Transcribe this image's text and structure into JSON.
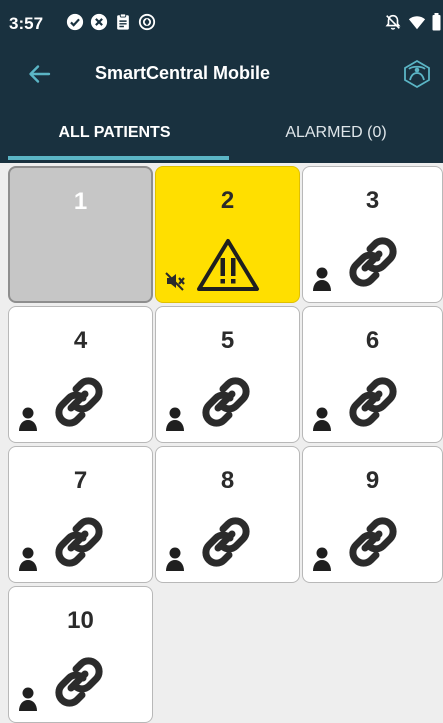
{
  "status": {
    "time": "3:57"
  },
  "app": {
    "title": "SmartCentral Mobile"
  },
  "tabs": {
    "all": "ALL PATIENTS",
    "alarmed": "ALARMED (0)"
  },
  "colors": {
    "header": "#19313f",
    "accent": "#5bb5c5",
    "alarm": "#ffdf00",
    "disabled": "#c6c6c6"
  },
  "beds": [
    {
      "number": "1",
      "state": "disabled"
    },
    {
      "number": "2",
      "state": "alarm",
      "icons": [
        "warning-icon",
        "muted-speaker-icon"
      ]
    },
    {
      "number": "3",
      "state": "linked",
      "icons": [
        "person-icon",
        "link-icon"
      ]
    },
    {
      "number": "4",
      "state": "linked",
      "icons": [
        "person-icon",
        "link-icon"
      ]
    },
    {
      "number": "5",
      "state": "linked",
      "icons": [
        "person-icon",
        "link-icon"
      ]
    },
    {
      "number": "6",
      "state": "linked",
      "icons": [
        "person-icon",
        "link-icon"
      ]
    },
    {
      "number": "7",
      "state": "linked",
      "icons": [
        "person-icon",
        "link-icon"
      ]
    },
    {
      "number": "8",
      "state": "linked",
      "icons": [
        "person-icon",
        "link-icon"
      ]
    },
    {
      "number": "9",
      "state": "linked",
      "icons": [
        "person-icon",
        "link-icon"
      ]
    },
    {
      "number": "10",
      "state": "linked",
      "icons": [
        "person-icon",
        "link-icon"
      ]
    }
  ]
}
